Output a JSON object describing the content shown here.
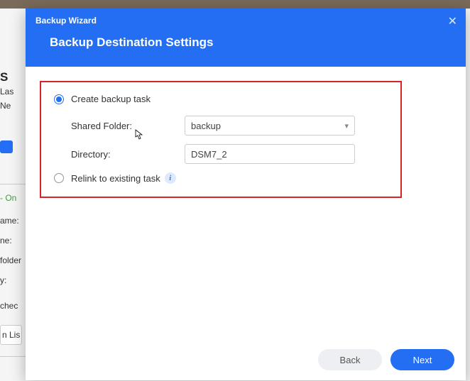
{
  "background": {
    "heading_fragment": "S",
    "line1": "Las",
    "line2": "Ne",
    "status": "- On",
    "label_name": "ame:",
    "label_ne": "ne:",
    "label_folder": "folder",
    "label_y": "y:",
    "label_chec": " chec",
    "btn_frag": "n Lis"
  },
  "modal": {
    "window_title": "Backup Wizard",
    "page_title": "Backup Destination Settings",
    "option_create": "Create backup task",
    "label_shared_folder": "Shared Folder:",
    "shared_folder_value": "backup",
    "label_directory": "Directory:",
    "directory_value": "DSM7_2",
    "option_relink": "Relink to existing task",
    "btn_back": "Back",
    "btn_next": "Next"
  }
}
